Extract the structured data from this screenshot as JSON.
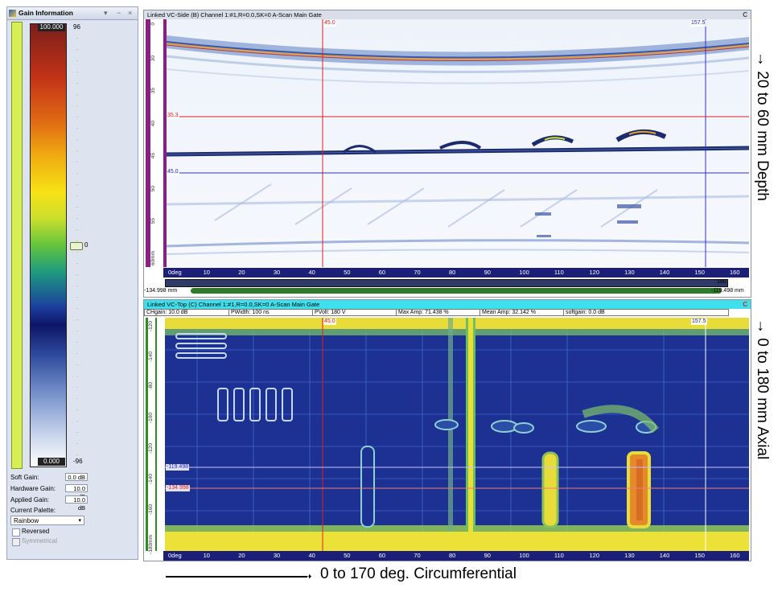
{
  "gain_panel": {
    "title": "Gain Information",
    "title_buttons": [
      "▾",
      "−",
      "×"
    ],
    "palette_max_label": "100.000",
    "palette_min_label": "0.000",
    "slider_top": "96",
    "slider_mid": "0",
    "slider_bottom": "-96",
    "soft_gain_label": "Soft Gain:",
    "soft_gain_value": "0.0 dB",
    "hardware_gain_label": "Hardware Gain:",
    "hardware_gain_value": "10.0 dB",
    "applied_gain_label": "Applied Gain:",
    "applied_gain_value": "10.0 dB",
    "current_palette_label": "Current Palette:",
    "current_palette_value": "Rainbow",
    "reversed_label": "Reversed",
    "symmetrical_label": "Symmetrical"
  },
  "top_pane": {
    "title": "Linked VC-Side (B) Channel 1:#1,R=0.0,SK=0 A-Scan Main Gate",
    "close_glyph": "C",
    "cursor_red_label": "45.0",
    "cursor_blue_label": "157.5",
    "hcursor_red_label": "35.3",
    "hcursor_blue_label": "45.0",
    "depth_ticks": [
      "0",
      "30",
      "35",
      "40",
      "45",
      "50",
      "55",
      "60mm"
    ],
    "axis_ticks": [
      "0deg",
      "10",
      "20",
      "30",
      "40",
      "50",
      "60",
      "70",
      "80",
      "90",
      "100",
      "110",
      "120",
      "130",
      "140",
      "150",
      "160"
    ],
    "scroll_left": "-134.998 mm",
    "scroll_right": "-119.498 mm",
    "scroll_right_top": "180"
  },
  "bottom_pane": {
    "title": "Linked VC-Top (C) Channel 1:#1,R=0.0,SK=0 A-Scan Main Gate",
    "close_glyph": "C",
    "info_fields": [
      "CHgain: 10.0 dB",
      "PWidth: 100 ns",
      "PVolt: 180 V",
      "Max Amp: 71.438 %",
      "Mean Amp: 32.142 %",
      "softgain: 0.0 dB"
    ],
    "cursor_red_label": "45.0",
    "cursor_blue_label": "157.5",
    "hcursor_blue_label": "-119.498",
    "hcursor_red_label": "-134.998",
    "axial_ticks": [
      "-120",
      "-140",
      "-80",
      "-100",
      "-120",
      "-140",
      "-160",
      "-180mm"
    ],
    "axis_ticks": [
      "0deg",
      "10",
      "20",
      "30",
      "40",
      "50",
      "60",
      "70",
      "80",
      "90",
      "100",
      "110",
      "120",
      "130",
      "140",
      "150",
      "160"
    ]
  },
  "annotations": {
    "depth": "→ 20 to 60 mm Depth",
    "axial": "→ 0 to 180 mm Axial",
    "circumferential": "0 to 170 deg. Circumferential"
  }
}
